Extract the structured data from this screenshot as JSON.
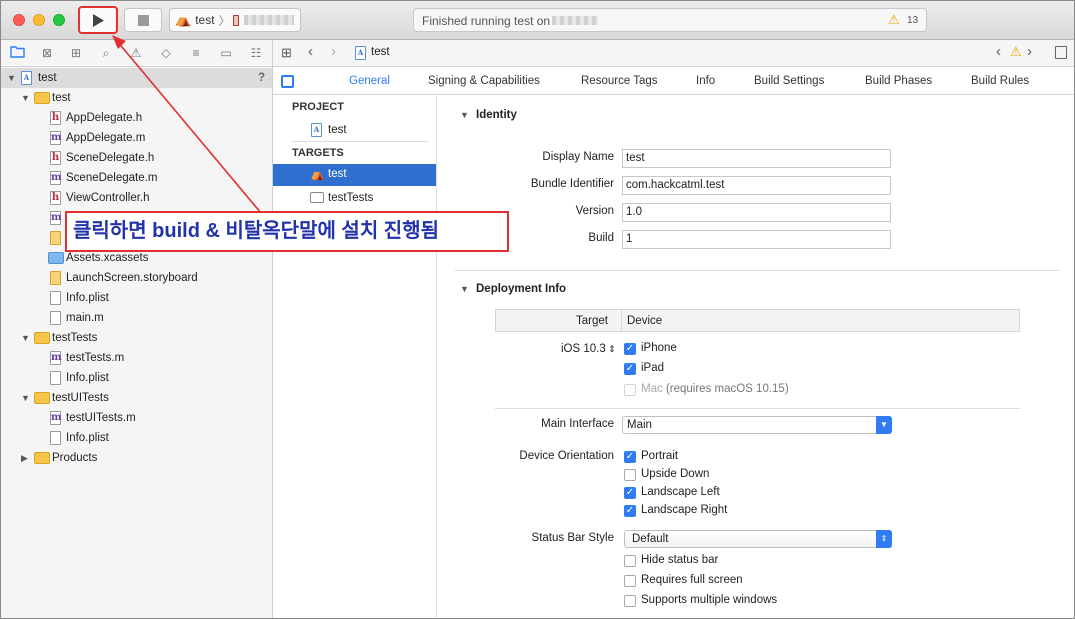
{
  "toolbar": {
    "scheme_target": "test",
    "status_text": "Finished running test on",
    "warning_count": "13"
  },
  "navigator": {
    "rows": [
      {
        "label": "test",
        "badge": "?"
      },
      {
        "label": "test"
      },
      {
        "label": "AppDelegate.h"
      },
      {
        "label": "AppDelegate.m"
      },
      {
        "label": "SceneDelegate.h"
      },
      {
        "label": "SceneDelegate.m"
      },
      {
        "label": "ViewController.h"
      },
      {
        "label": ""
      },
      {
        "label": ""
      },
      {
        "label": "Assets.xcassets"
      },
      {
        "label": "LaunchScreen.storyboard"
      },
      {
        "label": "Info.plist"
      },
      {
        "label": "main.m"
      },
      {
        "label": "testTests"
      },
      {
        "label": "testTests.m"
      },
      {
        "label": "Info.plist"
      },
      {
        "label": "testUITests"
      },
      {
        "label": "testUITests.m"
      },
      {
        "label": "Info.plist"
      },
      {
        "label": "Products"
      }
    ]
  },
  "jumpbar": {
    "file": "test"
  },
  "editor_tabs": [
    "General",
    "Signing & Capabilities",
    "Resource Tags",
    "Info",
    "Build Settings",
    "Build Phases",
    "Build Rules"
  ],
  "targets_list": {
    "project_header": "PROJECT",
    "project_item": "test",
    "targets_header": "TARGETS",
    "target_selected": "test",
    "target_other": "testTests"
  },
  "identity": {
    "title": "Identity",
    "display_name_label": "Display Name",
    "display_name": "test",
    "bundle_id_label": "Bundle Identifier",
    "bundle_id": "com.hackcatml.test",
    "version_label": "Version",
    "version": "1.0",
    "build_label": "Build",
    "build": "1"
  },
  "deployment": {
    "title": "Deployment Info",
    "col_target": "Target",
    "col_device": "Device",
    "ios_version": "iOS 10.3",
    "iphone": "iPhone",
    "ipad": "iPad",
    "mac": "Mac",
    "mac_note": "(requires macOS 10.15)",
    "main_interface_label": "Main Interface",
    "main_interface": "Main",
    "orientation_label": "Device Orientation",
    "portrait": "Portrait",
    "upside_down": "Upside Down",
    "landscape_left": "Landscape Left",
    "landscape_right": "Landscape Right",
    "status_bar_label": "Status Bar Style",
    "status_bar": "Default",
    "hide_status": "Hide status bar",
    "full_screen": "Requires full screen",
    "multi_windows": "Supports multiple windows"
  },
  "callout": {
    "text": "클릭하면 build & 비탈옥단말에 설치 진행됨"
  },
  "colors": {
    "accent": "#2f7cf6",
    "annotation": "#e23030",
    "folder": "#f5c54a"
  }
}
